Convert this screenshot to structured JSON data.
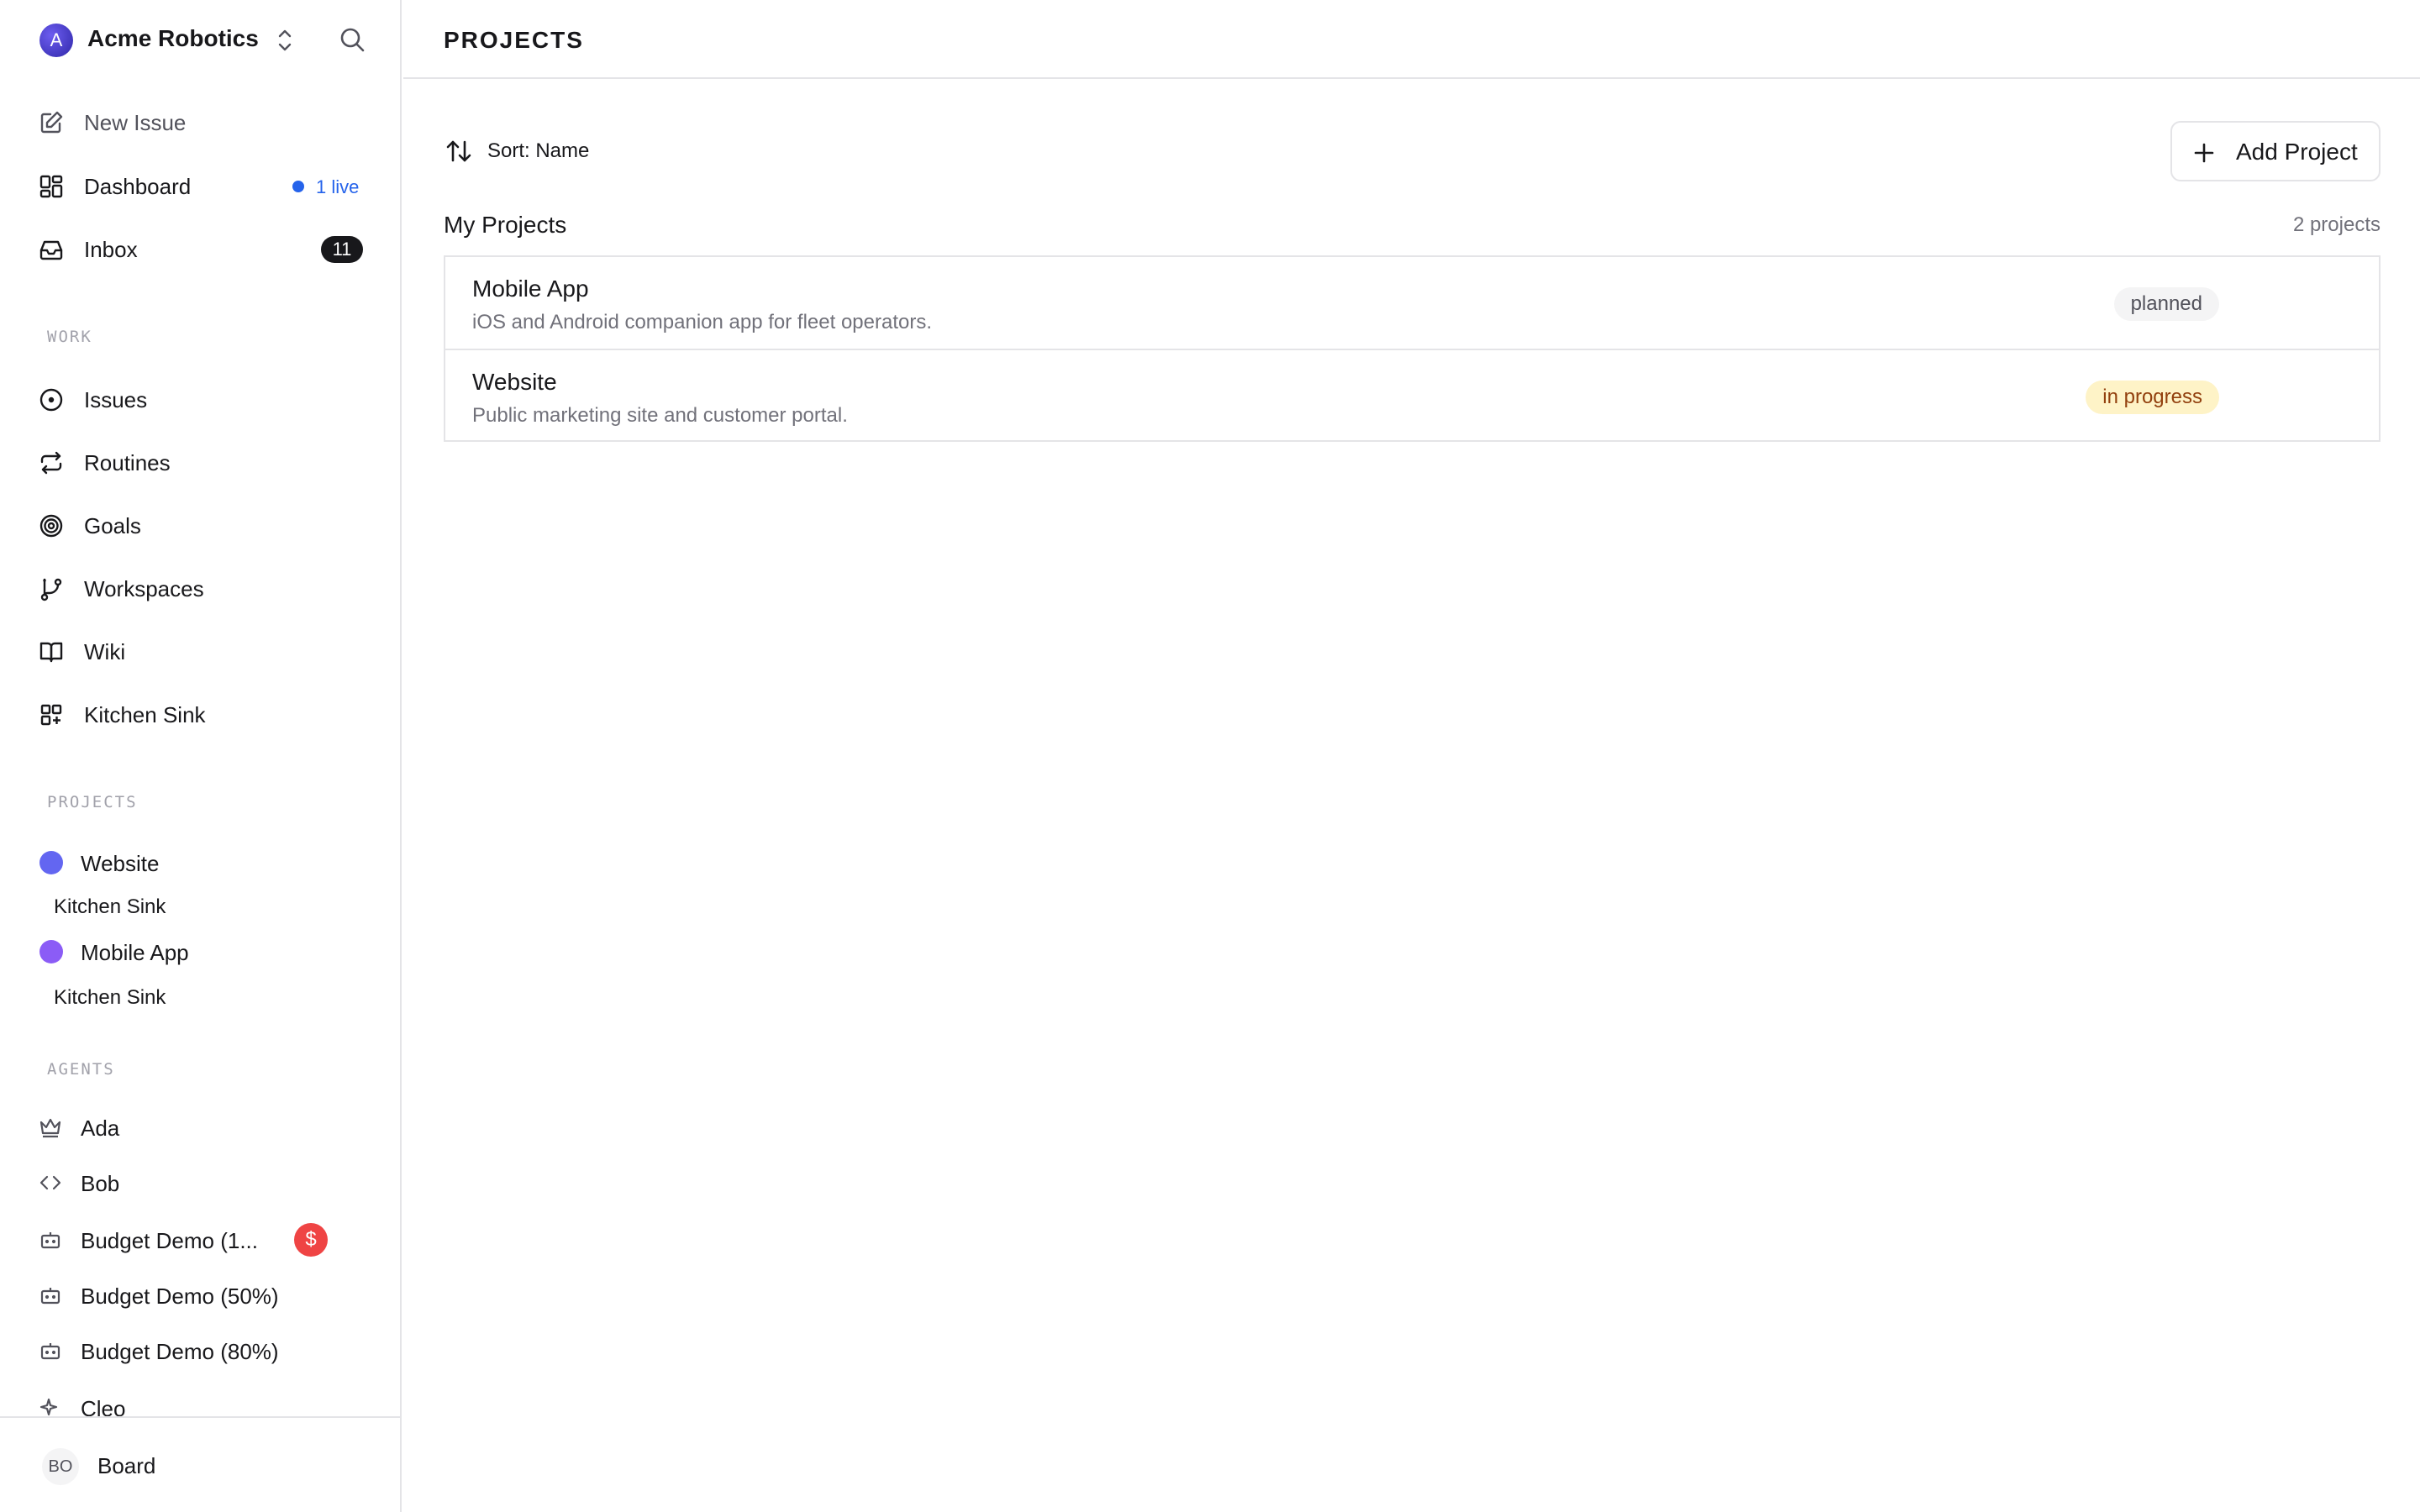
{
  "workspace": {
    "name": "Acme Robotics",
    "avatar_letter": "A"
  },
  "sidebar": {
    "top_items": [
      {
        "label": "New Issue",
        "icon": "edit-icon"
      },
      {
        "label": "Dashboard",
        "icon": "dashboard-icon",
        "live_label": "1 live"
      },
      {
        "label": "Inbox",
        "icon": "inbox-icon",
        "count": "11"
      }
    ],
    "work_label": "WORK",
    "work_items": [
      {
        "label": "Issues",
        "icon": "circle-dot-icon"
      },
      {
        "label": "Routines",
        "icon": "repeat-icon"
      },
      {
        "label": "Goals",
        "icon": "target-icon"
      },
      {
        "label": "Workspaces",
        "icon": "git-branch-icon"
      },
      {
        "label": "Wiki",
        "icon": "book-icon"
      },
      {
        "label": "Kitchen Sink",
        "icon": "shapes-icon"
      }
    ],
    "projects_label": "PROJECTS",
    "projects": [
      {
        "label": "Website",
        "color": "#6366f1",
        "sub": "Kitchen Sink"
      },
      {
        "label": "Mobile App",
        "color": "#8b5cf6",
        "sub": "Kitchen Sink"
      }
    ],
    "agents_label": "AGENTS",
    "agents": [
      {
        "label": "Ada",
        "icon": "crown-icon"
      },
      {
        "label": "Bob",
        "icon": "code-icon"
      },
      {
        "label": "Budget Demo (1...",
        "icon": "bot-icon",
        "badge": "$"
      },
      {
        "label": "Budget Demo (50%)",
        "icon": "bot-icon"
      },
      {
        "label": "Budget Demo (80%)",
        "icon": "bot-icon"
      },
      {
        "label": "Cleo",
        "icon": "sparkle-icon"
      }
    ],
    "user": {
      "initials": "BO",
      "name": "Board"
    }
  },
  "main": {
    "title": "PROJECTS",
    "sort_label": "Sort: Name",
    "add_label": "Add Project",
    "section_title": "My Projects",
    "section_count": "2 projects",
    "rows": [
      {
        "name": "Mobile App",
        "description": "iOS and Android companion app for fleet operators.",
        "status": "planned"
      },
      {
        "name": "Website",
        "description": "Public marketing site and customer portal.",
        "status": "in progress"
      }
    ]
  },
  "colors": {
    "accent_blue": "#2563eb",
    "planned_bg": "#f4f4f5",
    "in_progress_bg": "#fef3c7",
    "in_progress_text": "#92400e",
    "alert_red": "#ef4444"
  }
}
